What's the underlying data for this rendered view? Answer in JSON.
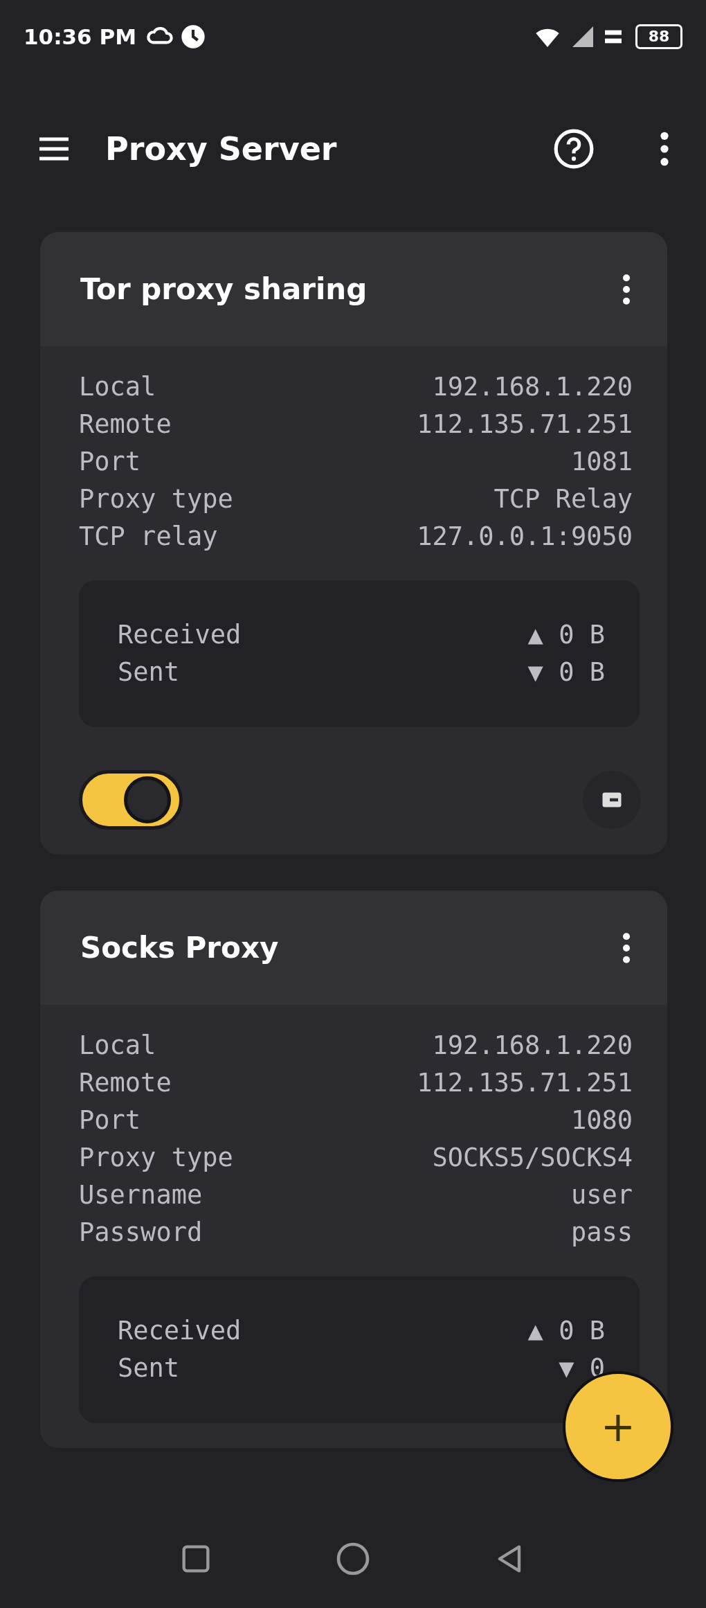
{
  "status_bar": {
    "time": "10:36 PM",
    "battery": "88"
  },
  "app_bar": {
    "title": "Proxy Server"
  },
  "cards": [
    {
      "title": "Tor proxy sharing",
      "details": [
        {
          "label": "Local",
          "value": "192.168.1.220"
        },
        {
          "label": "Remote",
          "value": "112.135.71.251"
        },
        {
          "label": "Port",
          "value": "1081"
        },
        {
          "label": "Proxy type",
          "value": "TCP Relay"
        },
        {
          "label": "TCP relay",
          "value": "127.0.0.1:9050"
        }
      ],
      "stats": [
        {
          "label": "Received",
          "value": "▲ 0 B"
        },
        {
          "label": "Sent",
          "value": "▼ 0 B"
        }
      ],
      "enabled": true
    },
    {
      "title": "Socks Proxy",
      "details": [
        {
          "label": "Local",
          "value": "192.168.1.220"
        },
        {
          "label": "Remote",
          "value": "112.135.71.251"
        },
        {
          "label": "Port",
          "value": "1080"
        },
        {
          "label": "Proxy type",
          "value": "SOCKS5/SOCKS4"
        },
        {
          "label": "Username",
          "value": "user"
        },
        {
          "label": "Password",
          "value": "pass"
        }
      ],
      "stats": [
        {
          "label": "Received",
          "value": "▲ 0 B"
        },
        {
          "label": "Sent",
          "value": "▼ 0"
        }
      ]
    }
  ],
  "fab": {
    "label": "+"
  }
}
